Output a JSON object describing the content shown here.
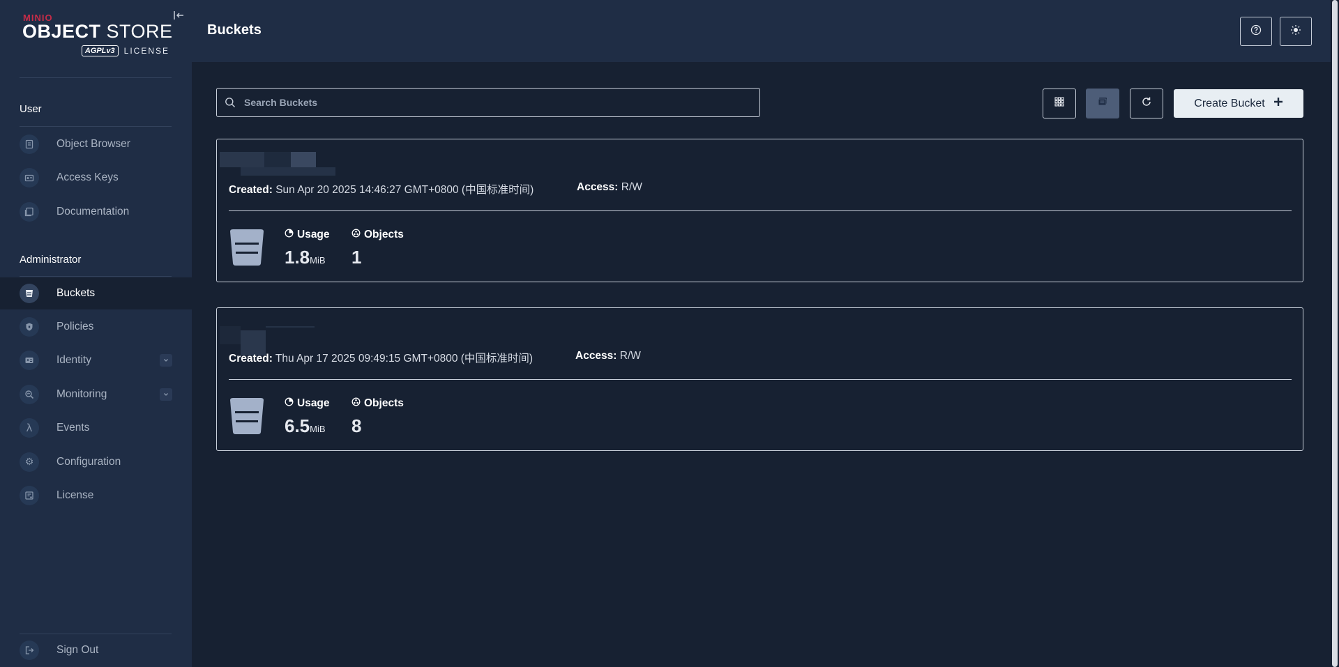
{
  "logo": {
    "brand": "MINIO",
    "product_bold": "OBJECT",
    "product_rest": " STORE",
    "edition": "AGPLv3",
    "license": "LICENSE"
  },
  "sidebar": {
    "user_section": "User",
    "user_items": [
      {
        "label": "Object Browser",
        "icon": "object-browser-icon"
      },
      {
        "label": "Access Keys",
        "icon": "access-keys-icon"
      },
      {
        "label": "Documentation",
        "icon": "documentation-icon"
      }
    ],
    "admin_section": "Administrator",
    "admin_items": [
      {
        "label": "Buckets",
        "icon": "bucket-icon",
        "active": true
      },
      {
        "label": "Policies",
        "icon": "policy-shield-icon"
      },
      {
        "label": "Identity",
        "icon": "identity-card-icon",
        "expandable": true
      },
      {
        "label": "Monitoring",
        "icon": "monitoring-icon",
        "expandable": true
      },
      {
        "label": "Events",
        "icon": "lambda-icon"
      },
      {
        "label": "Configuration",
        "icon": "gear-icon"
      },
      {
        "label": "License",
        "icon": "license-icon"
      }
    ],
    "sign_out": "Sign Out"
  },
  "header": {
    "title": "Buckets"
  },
  "toolbar": {
    "search_placeholder": "Search Buckets",
    "create_label": "Create Bucket"
  },
  "buckets": [
    {
      "created_label": "Created:",
      "created": "Sun Apr 20 2025 14:46:27 GMT+0800 (中国标准时间)",
      "access_label": "Access:",
      "access": "R/W",
      "usage_label": "Usage",
      "usage_value": "1.8",
      "usage_unit": "MiB",
      "objects_label": "Objects",
      "objects_value": "1"
    },
    {
      "created_label": "Created:",
      "created": "Thu Apr 17 2025 09:49:15 GMT+0800 (中国标准时间)",
      "access_label": "Access:",
      "access": "R/W",
      "usage_label": "Usage",
      "usage_value": "6.5",
      "usage_unit": "MiB",
      "objects_label": "Objects",
      "objects_value": "8"
    }
  ],
  "colors": {
    "sidebar": "#1f2d45",
    "main": "#172132",
    "accent_red": "#c72c48",
    "button_bg": "#e8eef3"
  }
}
